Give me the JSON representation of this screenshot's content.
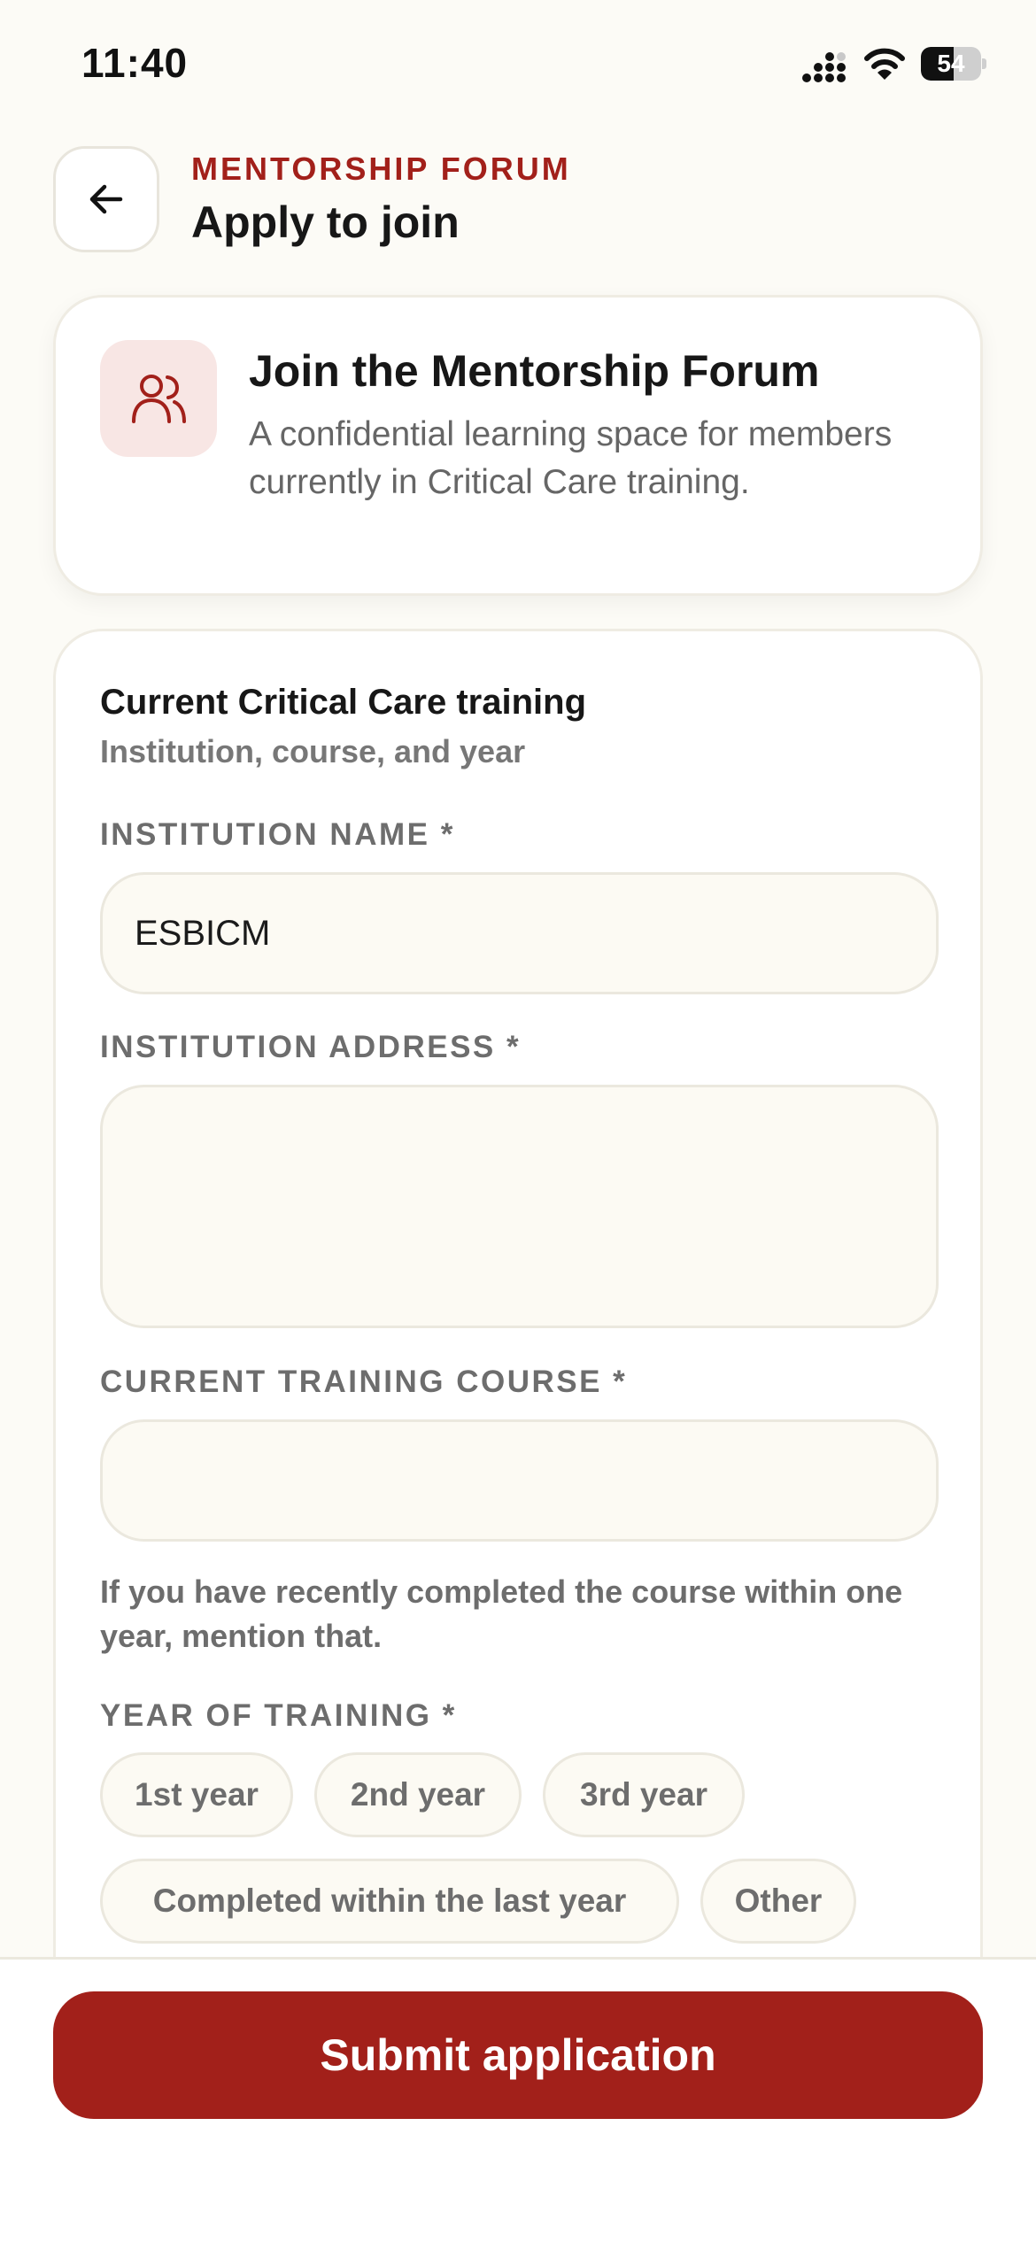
{
  "status_bar": {
    "time": "11:40",
    "battery_level": "54",
    "battery_fraction": 0.54
  },
  "header": {
    "eyebrow": "MENTORSHIP FORUM",
    "title": "Apply to join",
    "back_icon": "arrow-left-icon"
  },
  "intro": {
    "icon": "users-icon",
    "title": "Join the Mentorship Forum",
    "description": "A confidential learning space for members currently in Critical Care training."
  },
  "form": {
    "section_title": "Current Critical Care training",
    "section_subtitle": "Institution, course, and year",
    "institution_name": {
      "label": "INSTITUTION NAME *",
      "value": "ESBICM"
    },
    "institution_address": {
      "label": "INSTITUTION ADDRESS *",
      "value": ""
    },
    "training_course": {
      "label": "CURRENT TRAINING COURSE *",
      "value": ""
    },
    "helper_text": "If you have recently completed the course within one year, mention that.",
    "year_of_training": {
      "label": "YEAR OF TRAINING *",
      "options": [
        "1st year",
        "2nd year",
        "3rd year",
        "Completed within the last year",
        "Other"
      ]
    }
  },
  "footer": {
    "submit_label": "Submit application"
  },
  "colors": {
    "accent": "#a2201a",
    "background": "#fcfbf6",
    "icon_bg": "#f8e6e4"
  }
}
